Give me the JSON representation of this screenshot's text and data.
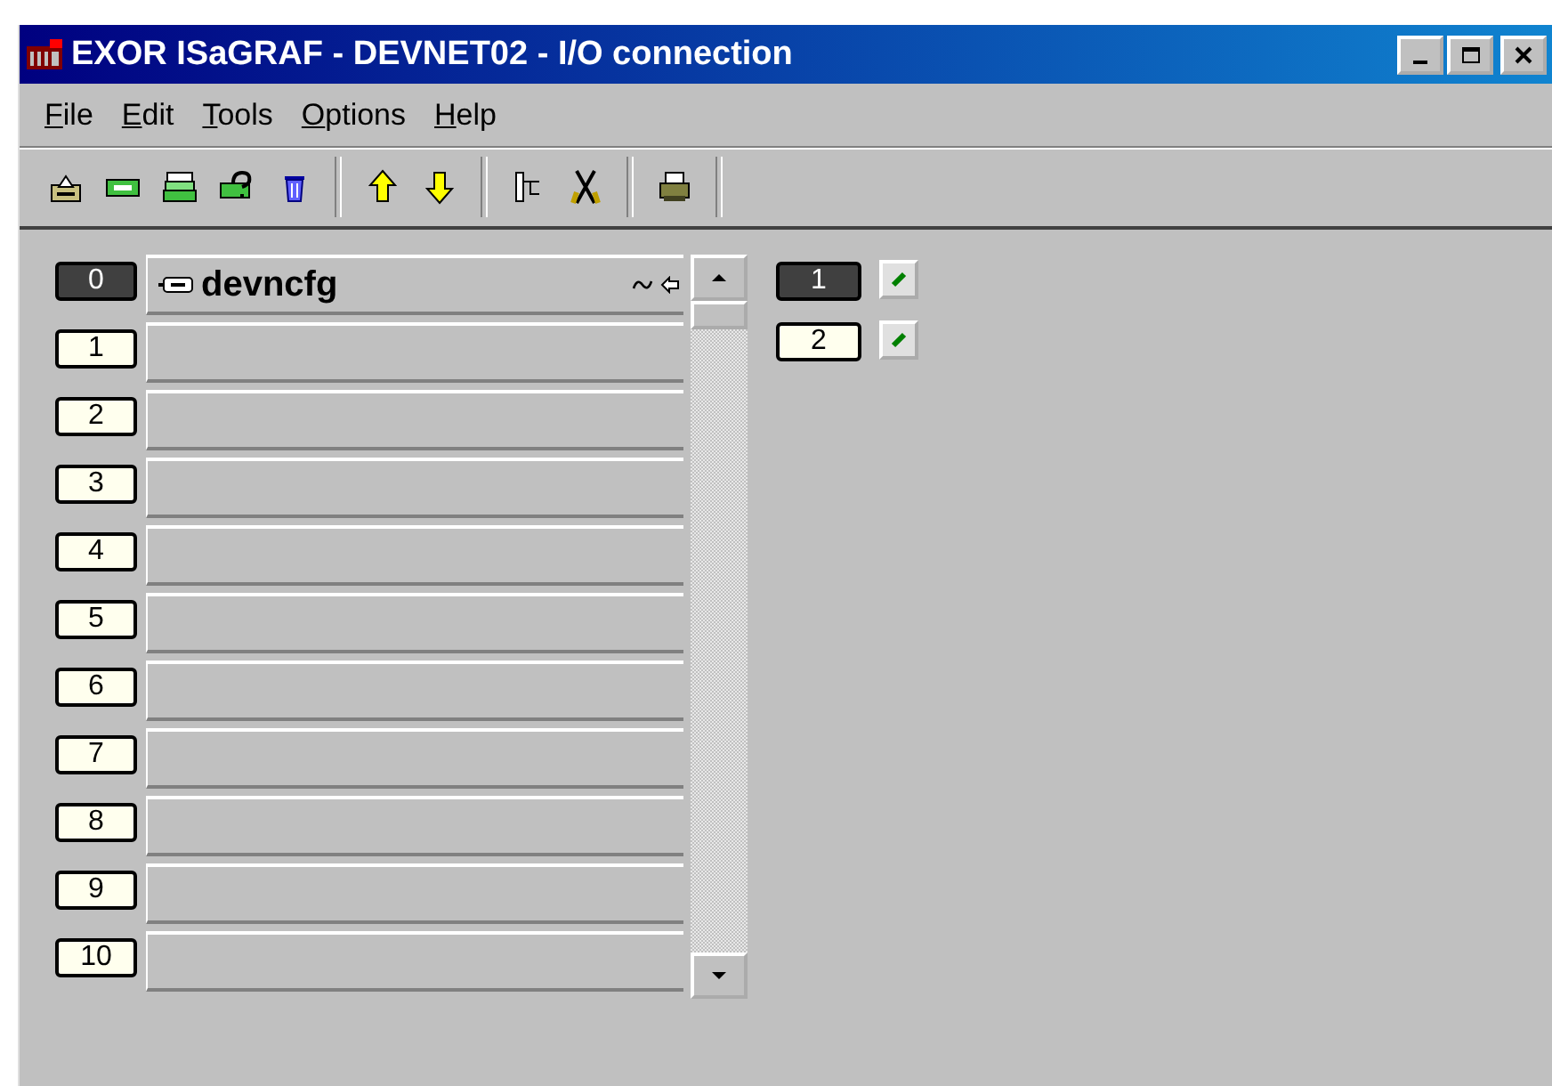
{
  "window": {
    "title": "EXOR ISaGRAF - DEVNET02 - I/O connection"
  },
  "menu": [
    {
      "label": "File"
    },
    {
      "label": "Edit"
    },
    {
      "label": "Tools"
    },
    {
      "label": "Options"
    },
    {
      "label": "Help"
    }
  ],
  "slots": [
    {
      "number": "0",
      "selected": true,
      "board": "devncfg"
    },
    {
      "number": "1",
      "selected": false
    },
    {
      "number": "2",
      "selected": false
    },
    {
      "number": "3",
      "selected": false
    },
    {
      "number": "4",
      "selected": false
    },
    {
      "number": "5",
      "selected": false
    },
    {
      "number": "6",
      "selected": false
    },
    {
      "number": "7",
      "selected": false
    },
    {
      "number": "8",
      "selected": false
    },
    {
      "number": "9",
      "selected": false
    },
    {
      "number": "10",
      "selected": false
    }
  ],
  "channels": [
    {
      "number": "1",
      "selected": true
    },
    {
      "number": "2",
      "selected": false
    }
  ]
}
